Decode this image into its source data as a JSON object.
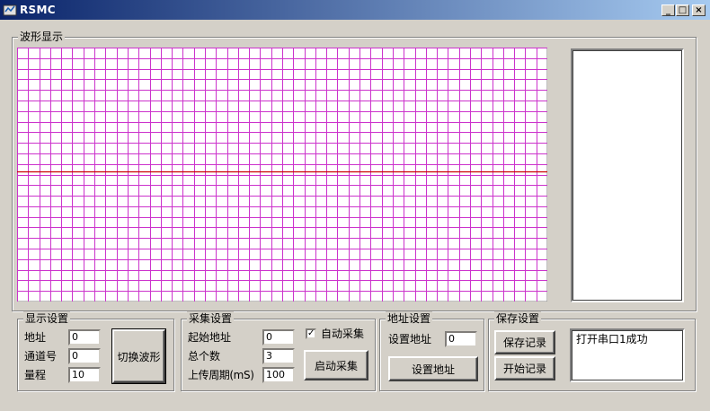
{
  "window": {
    "title": "RSMC",
    "minimize": "_",
    "maximize": "□",
    "close": "×"
  },
  "waveform": {
    "group_label": "波形显示",
    "grid_color": "#cc33cc",
    "baseline_color": "#cc0000",
    "rows": 24,
    "cols": 48,
    "baseline_row": 11
  },
  "display_settings": {
    "label": "显示设置",
    "address_label": "地址",
    "address_value": "0",
    "channel_label": "通道号",
    "channel_value": "0",
    "range_label": "量程",
    "range_value": "10",
    "switch_button": "切换波形"
  },
  "acquisition_settings": {
    "label": "采集设置",
    "start_address_label": "起始地址",
    "start_address_value": "0",
    "total_count_label": "总个数",
    "total_count_value": "3",
    "upload_period_label": "上传周期(mS)",
    "upload_period_value": "100",
    "auto_collect_label": "自动采集",
    "auto_collect_checked": true,
    "start_button": "启动采集"
  },
  "address_settings": {
    "label": "地址设置",
    "set_address_label": "设置地址",
    "set_address_value": "0",
    "set_address_button": "设置地址"
  },
  "save_settings": {
    "label": "保存设置",
    "save_record_button": "保存记录",
    "start_record_button": "开始记录",
    "log_text": "打开串口1成功"
  }
}
